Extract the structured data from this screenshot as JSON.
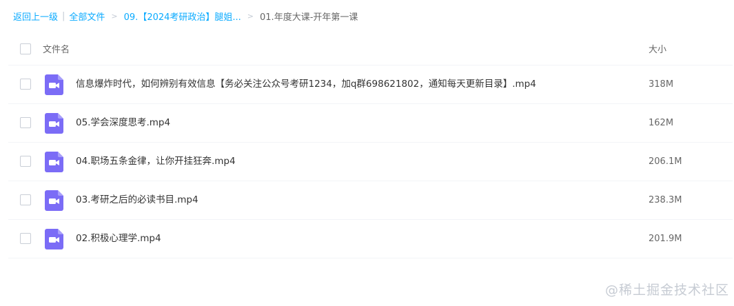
{
  "breadcrumb": {
    "back": "返回上一级",
    "separator": "|",
    "all_files": "全部文件",
    "arrow": ">",
    "folder": "09.【2024考研政治】腿姐...",
    "current": "01.年度大课-开年第一课"
  },
  "table": {
    "name_header": "文件名",
    "size_header": "大小"
  },
  "files": [
    {
      "name": "信息爆炸时代，如何辨别有效信息【务必关注公众号考研1234，加q群698621802，通知每天更新目录】.mp4",
      "size": "318M",
      "icon": "video-file-icon"
    },
    {
      "name": "05.学会深度思考.mp4",
      "size": "162M",
      "icon": "video-file-icon"
    },
    {
      "name": "04.职场五条金律，让你开挂狂奔.mp4",
      "size": "206.1M",
      "icon": "video-file-icon"
    },
    {
      "name": "03.考研之后的必读书目.mp4",
      "size": "238.3M",
      "icon": "video-file-icon"
    },
    {
      "name": "02.积极心理学.mp4",
      "size": "201.9M",
      "icon": "video-file-icon"
    }
  ],
  "watermark": "@稀土掘金技术社区",
  "colors": {
    "link": "#09aaff",
    "icon": "#7b6cf6",
    "separator": "#c3cad4",
    "divider": "#f2f4f7"
  }
}
